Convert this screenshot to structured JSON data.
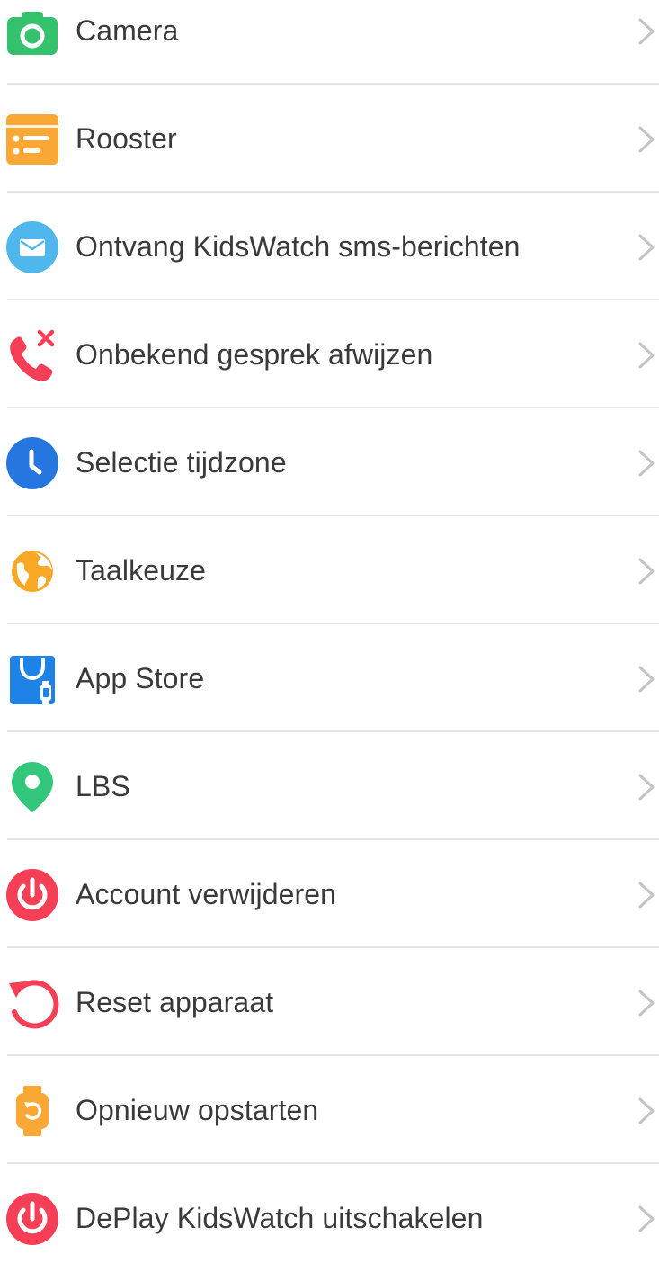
{
  "settings": {
    "items": [
      {
        "label": "Camera",
        "icon": "camera-icon",
        "color": "#35c26c"
      },
      {
        "label": "Rooster",
        "icon": "schedule-icon",
        "color": "#f9a836"
      },
      {
        "label": "Ontvang KidsWatch sms-berichten",
        "icon": "message-icon",
        "color": "#4fb7ec"
      },
      {
        "label": "Onbekend gesprek afwijzen",
        "icon": "reject-call-icon",
        "color": "#f43f56"
      },
      {
        "label": "Selectie tijdzone",
        "icon": "clock-icon",
        "color": "#2676e0"
      },
      {
        "label": "Taalkeuze",
        "icon": "globe-icon",
        "color": "#f9a825"
      },
      {
        "label": "App Store",
        "icon": "app-store-icon",
        "color": "#1e82e6"
      },
      {
        "label": "LBS",
        "icon": "location-pin-icon",
        "color": "#32c77b"
      },
      {
        "label": "Account verwijderen",
        "icon": "power-icon",
        "color": "#f43f56"
      },
      {
        "label": "Reset apparaat",
        "icon": "reset-icon",
        "color": "#f43f56"
      },
      {
        "label": "Opnieuw opstarten",
        "icon": "watch-restart-icon",
        "color": "#f9a836"
      },
      {
        "label": "DePlay KidsWatch uitschakelen",
        "icon": "power-icon",
        "color": "#f43f56"
      }
    ]
  }
}
